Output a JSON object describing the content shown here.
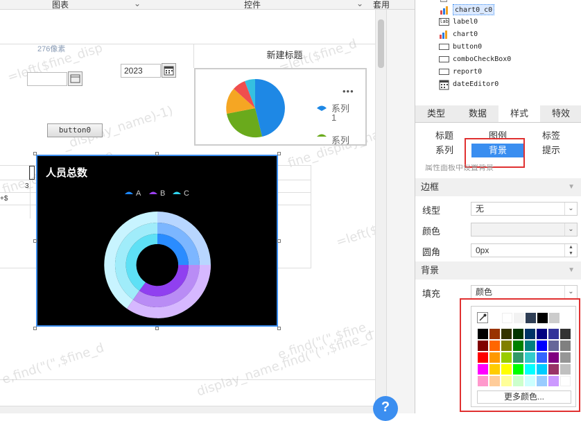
{
  "topbar": {
    "chart_tab": "图表",
    "widget_tab": "控件",
    "apply_tab": "套用"
  },
  "canvas": {
    "pixel_label": "276像素",
    "date_value": "2023",
    "button0_label": "button0",
    "pie_widget": {
      "title": "新建标题",
      "menu": "•••",
      "legend_series1": "系列",
      "legend_series1_line2": "1",
      "legend_series2": "系列"
    },
    "table_cell": "3",
    "table_cell2": "+$",
    "watermarks": [
      "=left($fine_disp",
      "=left($fine_d",
      "_display_name)-1)",
      "fine_display_name",
      "fine_display_nam",
      "=left($",
      "e,find(\"(\",$fine_d",
      "display_name,find(\"(\",$fine_d",
      "e,find(\"(\",$fine_"
    ]
  },
  "donut_chart": {
    "title": "人员总数",
    "legend": [
      "A",
      "B",
      "C"
    ],
    "colors": {
      "A": "#1e88ff",
      "B": "#9b40f0",
      "C": "#30d6f0"
    }
  },
  "tree": [
    {
      "label": "chart0_c0",
      "icon": "chart-icon",
      "selected": true
    },
    {
      "label": "label0",
      "icon": "label-icon"
    },
    {
      "label": "chart0",
      "icon": "chart-icon"
    },
    {
      "label": "button0",
      "icon": "button-icon"
    },
    {
      "label": "comboCheckBox0",
      "icon": "combobox-icon"
    },
    {
      "label": "report0",
      "icon": "report-icon"
    },
    {
      "label": "dateEditor0",
      "icon": "calendar-icon"
    }
  ],
  "main_tabs": [
    "类型",
    "数据",
    "样式",
    "特效"
  ],
  "active_main_tab": "样式",
  "sub_tabs": [
    "标题",
    "图例",
    "标签",
    "系列",
    "背景",
    "提示"
  ],
  "active_sub_tab": "背景",
  "hint": "属性面板中设置背景",
  "border_section": {
    "title": "边框",
    "line_type_label": "线型",
    "line_type_value": "无",
    "color_label": "颜色",
    "radius_label": "圆角",
    "radius_value": "0px"
  },
  "background_section": {
    "title": "背景",
    "fill_label": "填充",
    "fill_value": "颜色"
  },
  "color_picker": {
    "more_colors": "更多颜色...",
    "recent": [
      "#ffffff",
      "#f2f2f2",
      "#2f3e55",
      "#000000",
      "#cccccc"
    ],
    "grid": [
      [
        "#000000",
        "#993300",
        "#333300",
        "#003300",
        "#003366",
        "#000080",
        "#333399",
        "#333333"
      ],
      [
        "#800000",
        "#ff6600",
        "#808000",
        "#008000",
        "#008080",
        "#0000ff",
        "#666699",
        "#808080"
      ],
      [
        "#ff0000",
        "#ff9900",
        "#99cc00",
        "#339966",
        "#33cccc",
        "#3366ff",
        "#800080",
        "#969696"
      ],
      [
        "#ff00ff",
        "#ffcc00",
        "#ffff00",
        "#00ff00",
        "#00ffff",
        "#00ccff",
        "#993366",
        "#c0c0c0"
      ],
      [
        "#ff99cc",
        "#ffcc99",
        "#ffff99",
        "#ccffcc",
        "#ccffff",
        "#99ccff",
        "#cc99ff",
        "#ffffff"
      ]
    ]
  },
  "help_button": "?"
}
